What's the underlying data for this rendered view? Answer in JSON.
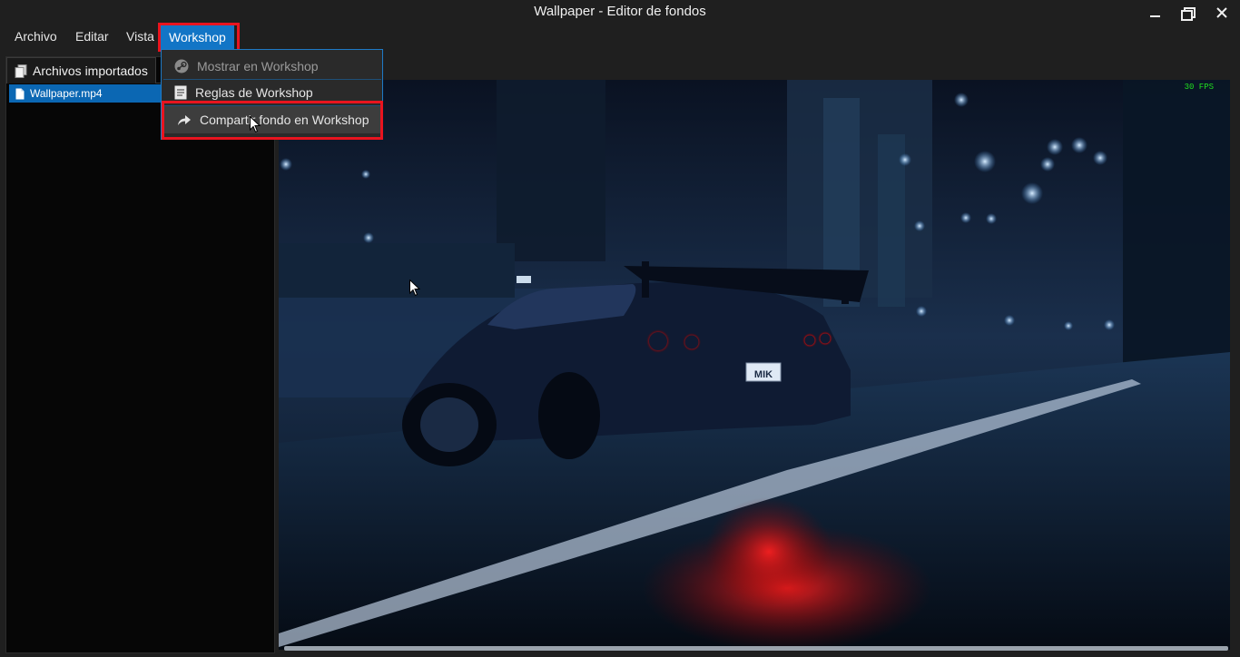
{
  "window": {
    "title": "Wallpaper - Editor de fondos"
  },
  "menubar": {
    "items": [
      "Archivo",
      "Editar",
      "Vista",
      "Workshop"
    ],
    "active": "Workshop"
  },
  "workshop_menu": {
    "items": [
      {
        "label": "Mostrar en Workshop",
        "icon": "steam-icon",
        "enabled": false
      },
      {
        "label": "Reglas de Workshop",
        "icon": "document-icon",
        "enabled": true
      },
      {
        "label": "Compartir fondo en Workshop",
        "icon": "share-arrow-icon",
        "enabled": true,
        "hovered": true
      }
    ]
  },
  "left_panel": {
    "tab_label": "Archivos importados",
    "files": [
      "Wallpaper.mp4"
    ],
    "selected": "Wallpaper.mp4"
  },
  "preview": {
    "fps_label": "30 FPS",
    "plate_text": "MIK"
  },
  "colors": {
    "accent": "#1275c6",
    "highlight_box": "#e8141f",
    "fps": "#20e020"
  }
}
